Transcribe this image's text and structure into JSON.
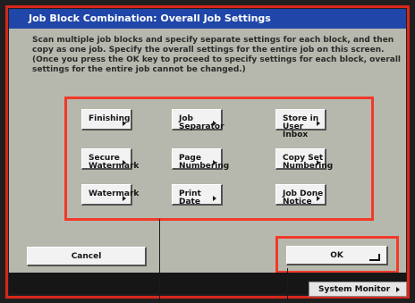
{
  "window": {
    "title": "Job Block Combination: Overall Job Settings",
    "instructions": [
      "Scan multiple job blocks and specify separate settings for each block, and then",
      "copy as one job. Specify the overall settings for the entire job on this screen.",
      "(Once you press the OK key to proceed to specify settings for each block, overall",
      "settings for the entire job cannot be changed.)"
    ]
  },
  "buttons": {
    "finishing": [
      "Finishing"
    ],
    "job_separator": [
      "Job",
      "Separator"
    ],
    "store_in_user_inbox": [
      "Store in",
      "User Inbox"
    ],
    "secure_watermark": [
      "Secure",
      "Watermark"
    ],
    "page_numbering": [
      "Page",
      "Numbering"
    ],
    "copy_set_numbering": [
      "Copy Set",
      "Numbering"
    ],
    "watermark": [
      "Watermark"
    ],
    "print_date": [
      "Print Date"
    ],
    "job_done_notice": [
      "Job Done",
      "Notice"
    ],
    "cancel": "Cancel",
    "ok": "OK",
    "system_monitor": "System Monitor"
  },
  "colors": {
    "title_bar": "#1f46a8",
    "panel": "#b7b8ad",
    "highlight": "#f03a2a"
  },
  "icons": {
    "submenu": "right-arrow-icon",
    "enter": "enter-icon"
  }
}
